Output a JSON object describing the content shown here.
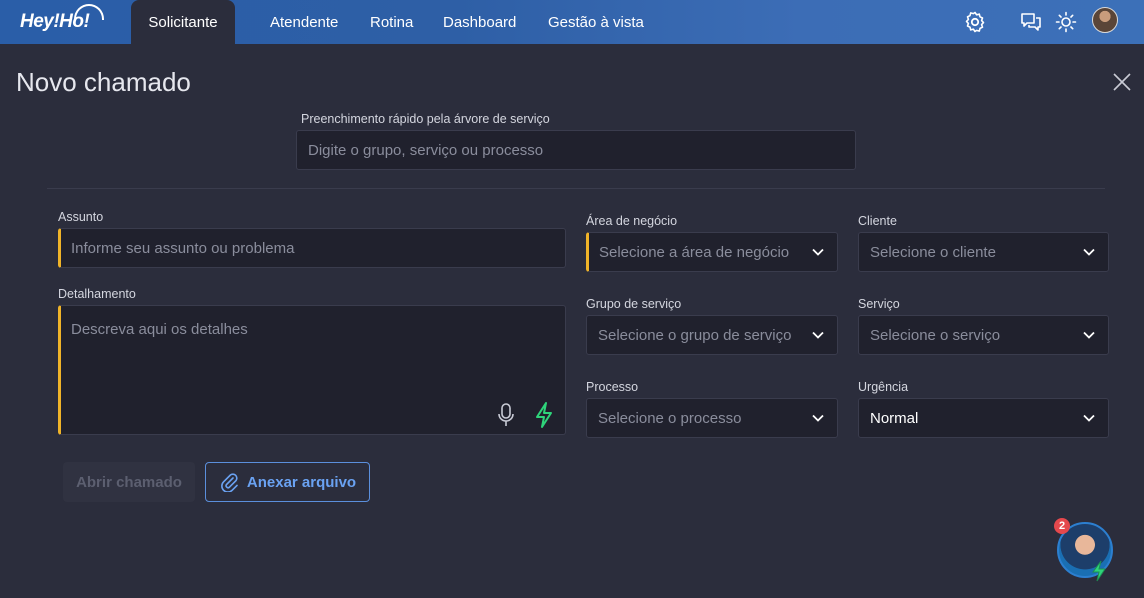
{
  "nav": {
    "logo": "Hey!Ho!",
    "tabs": [
      {
        "label": "Solicitante",
        "active": true
      },
      {
        "label": "Atendente"
      },
      {
        "label": "Rotina"
      },
      {
        "label": "Dashboard"
      },
      {
        "label": "Gestão à vista"
      }
    ],
    "icons": [
      "gear-icon",
      "chat-icon",
      "sun-icon",
      "avatar"
    ]
  },
  "page": {
    "title": "Novo chamado"
  },
  "quick_fill": {
    "label": "Preenchimento rápido pela árvore de serviço",
    "placeholder": "Digite o grupo, serviço ou processo"
  },
  "form": {
    "assunto": {
      "label": "Assunto",
      "placeholder": "Informe seu assunto ou problema"
    },
    "detalhamento": {
      "label": "Detalhamento",
      "placeholder": "Descreva aqui os detalhes"
    },
    "area_negocio": {
      "label": "Área de negócio",
      "placeholder": "Selecione a área de negócio"
    },
    "cliente": {
      "label": "Cliente",
      "placeholder": "Selecione o cliente"
    },
    "grupo_servico": {
      "label": "Grupo de serviço",
      "placeholder": "Selecione o grupo de serviço"
    },
    "servico": {
      "label": "Serviço",
      "placeholder": "Selecione o serviço"
    },
    "processo": {
      "label": "Processo",
      "placeholder": "Selecione o processo"
    },
    "urgencia": {
      "label": "Urgência",
      "value": "Normal"
    }
  },
  "actions": {
    "submit_label": "Abrir chamado",
    "attach_label": "Anexar arquivo"
  },
  "assistant": {
    "badge_count": "2"
  },
  "colors": {
    "accent_required": "#f0b429",
    "primary_link": "#6aa2f2",
    "background": "#2b2d3c",
    "nav_gradient_start": "#2a5ea8"
  }
}
